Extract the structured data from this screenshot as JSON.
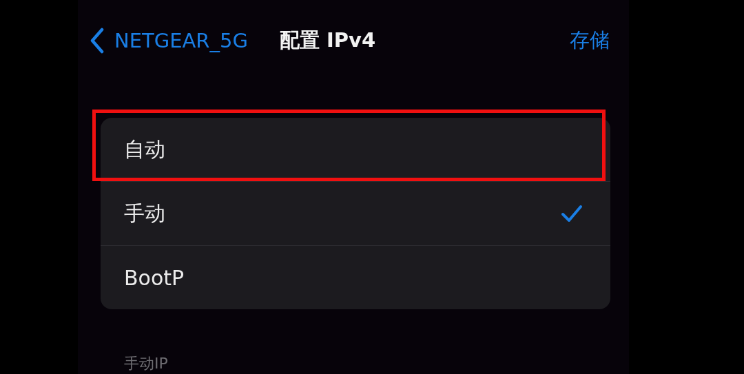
{
  "nav": {
    "back": "NETGEAR_5G",
    "title": "配置 IPv4",
    "action": "存储"
  },
  "options": [
    {
      "label": "自动",
      "selected": false,
      "highlighted": true
    },
    {
      "label": "手动",
      "selected": true,
      "highlighted": false
    },
    {
      "label": "BootP",
      "selected": false,
      "highlighted": false
    }
  ],
  "section_header": "手动IP"
}
